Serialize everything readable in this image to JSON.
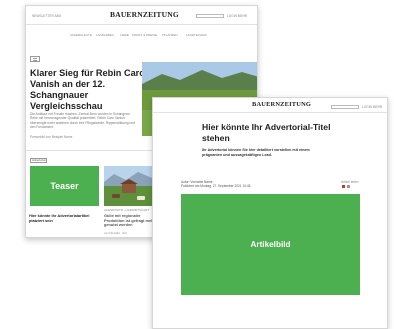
{
  "back_page": {
    "header": {
      "left_links": "NEWSLETTER  ABO",
      "logo": "BAUERNZEITUNG",
      "right_links": "LOGIN   MEHR"
    },
    "nav": [
      "AKKERSLEUTE",
      "LANDLEBEN",
      "TIERE",
      "MARKT & PREISE",
      "PFLANZEN",
      "LANDTECHNIK"
    ],
    "hero": {
      "headline": "Klarer Sieg für Rebin Caro Vanish an der 12. Schangnauer Vergleichsschau",
      "lead": "Die Anlässe mit Freude machen. Zentral-Bern wurden in Schangnau Rehe mit hervorragender Qualität präsentiert. Rebin Caro Vanish überzeugte unter anderem durch ihre Pfingstweide, Rippenwölbung und den Fundament.",
      "meta": "Pressebild von Beispiel Name"
    },
    "teaser_card": {
      "badge": "Advertorial",
      "placeholder": "Teaser",
      "title": "Hier könnte Ihr Advertorialartikel platziert sein"
    },
    "second_card": {
      "kicker": "AGRARPOLITIK · LANDWIRTSCHAFT",
      "title": "Gülle mit regionaler Produktion ist gefragt mehr genutzt werden",
      "meta": "vor 2 Stunden · Ref"
    }
  },
  "front_page": {
    "header": {
      "logo": "BAUERNZEITUNG",
      "right_links": "LOGIN   MEHR"
    },
    "title": "Hier könnte Ihr Advertorial-Titel stehen",
    "lead": "Ihr Advertorial können Sie hier detailliert vorstellen mit einem prägnanten und aussagekräftigen Lead.",
    "byline_author": "Autor: Vorname Name",
    "byline_date": "Publiziert am Montag, 27. September 2021 10:45",
    "share_label": "Artikel teilen",
    "image_placeholder": "Artikelbild"
  },
  "colors": {
    "placeholder_green": "#4caf50",
    "accent_red": "#c2392b"
  }
}
